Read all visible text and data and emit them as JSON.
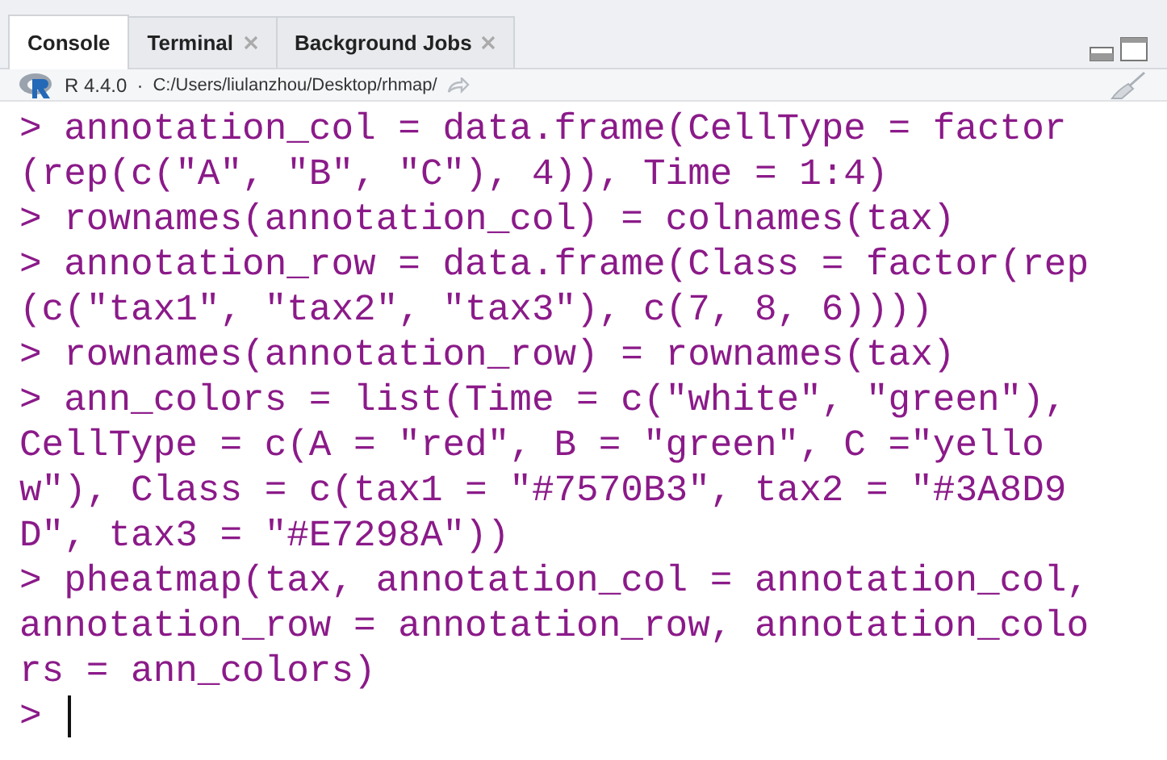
{
  "tabs": [
    {
      "label": "Console",
      "selected": true,
      "closable": false
    },
    {
      "label": "Terminal",
      "selected": false,
      "closable": true
    },
    {
      "label": "Background Jobs",
      "selected": false,
      "closable": true
    }
  ],
  "toolbar": {
    "version": "R 4.4.0",
    "separator": "·",
    "path": "C:/Users/liulanzhou/Desktop/rhmap/"
  },
  "console": {
    "lines": [
      "> annotation_col = data.frame(CellType = factor",
      "(rep(c(\"A\", \"B\", \"C\"), 4)), Time = 1:4)",
      "> rownames(annotation_col) = colnames(tax)",
      "> annotation_row = data.frame(Class = factor(rep",
      "(c(\"tax1\", \"tax2\", \"tax3\"), c(7, 8, 6))))",
      "> rownames(annotation_row) = rownames(tax)",
      "> ann_colors = list(Time = c(\"white\", \"green\"),",
      "CellType = c(A = \"red\", B = \"green\", C =\"yello",
      "w\"), Class = c(tax1 = \"#7570B3\", tax2 = \"#3A8D9",
      "D\", tax3 = \"#E7298A\"))",
      "> pheatmap(tax, annotation_col = annotation_col,",
      "annotation_row = annotation_row, annotation_colo",
      "rs = ann_colors)"
    ],
    "prompt": ">"
  }
}
